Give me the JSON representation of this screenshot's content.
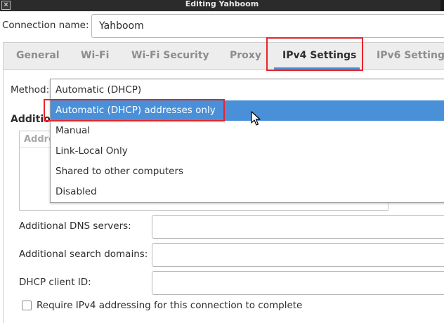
{
  "window": {
    "title": "Editing Yahboom",
    "close_glyph": "×"
  },
  "connection": {
    "label": "Connection name:",
    "value": "Yahboom"
  },
  "tabs": [
    {
      "label": "General",
      "active": false
    },
    {
      "label": "Wi-Fi",
      "active": false
    },
    {
      "label": "Wi-Fi Security",
      "active": false
    },
    {
      "label": "Proxy",
      "active": false
    },
    {
      "label": "IPv4 Settings",
      "active": true
    },
    {
      "label": "IPv6 Settings",
      "active": false
    }
  ],
  "method": {
    "label": "Method:",
    "options": [
      "Automatic (DHCP)",
      "Automatic (DHCP) addresses only",
      "Manual",
      "Link-Local Only",
      "Shared to other computers",
      "Disabled"
    ],
    "highlighted": "Automatic (DHCP) addresses only"
  },
  "addresses": {
    "heading": "Additio",
    "column_header": "Addre"
  },
  "fields": {
    "dns_label": "Additional DNS servers:",
    "dns_value": "",
    "search_label": "Additional search domains:",
    "search_value": "",
    "dhcp_label": "DHCP client ID:",
    "dhcp_value": ""
  },
  "require_ipv4": {
    "label": "Require IPv4 addressing for this connection to complete",
    "checked": false
  },
  "colors": {
    "accent": "#4a90d9",
    "annotation": "#e8242a"
  },
  "icons": {
    "pointer": "mouse-pointer-icon"
  }
}
